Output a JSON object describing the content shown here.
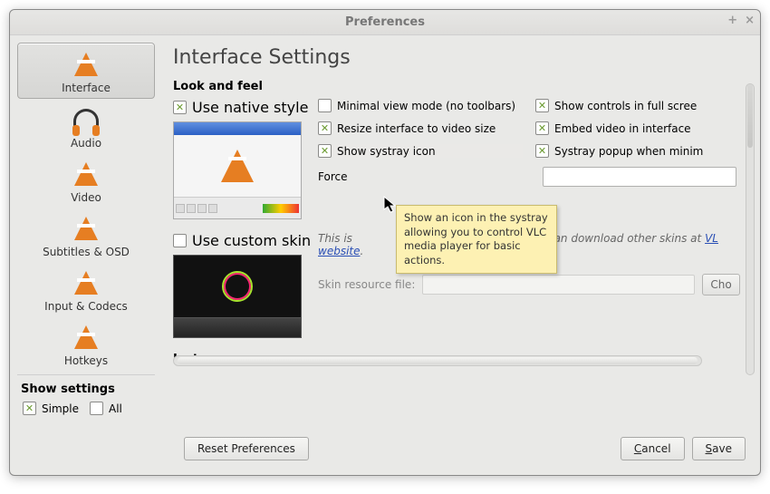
{
  "window": {
    "title": "Preferences"
  },
  "sidebar": {
    "items": [
      {
        "label": "Interface"
      },
      {
        "label": "Audio"
      },
      {
        "label": "Video"
      },
      {
        "label": "Subtitles & OSD"
      },
      {
        "label": "Input & Codecs"
      },
      {
        "label": "Hotkeys"
      }
    ],
    "show_settings": "Show settings",
    "simple": "Simple",
    "all": "All"
  },
  "heading": "Interface Settings",
  "look": {
    "title": "Look and feel",
    "native": "Use native style",
    "minimal": "Minimal view mode (no toolbars)",
    "resize": "Resize interface to video size",
    "systray": "Show systray icon",
    "controls": "Show controls in full scree",
    "embed": "Embed video in interface",
    "popup": "Systray popup when minim",
    "force_label": "Force ",
    "custom": "Use custom skin",
    "skin_note_a": "This is",
    "skin_note_b": ". You can download other skins at ",
    "skin_link_a": "VL",
    "skin_link_b": "website",
    "skin_file": "Skin resource file:",
    "choose": "Cho"
  },
  "instances": {
    "title": "Instances"
  },
  "tooltip": "Show an icon in the systray allowing you to control VLC media player for basic actions.",
  "footer": {
    "reset": "Reset Preferences",
    "cancel": "Cancel",
    "cancel_u": "C",
    "save": "Save",
    "save_u": "S"
  }
}
